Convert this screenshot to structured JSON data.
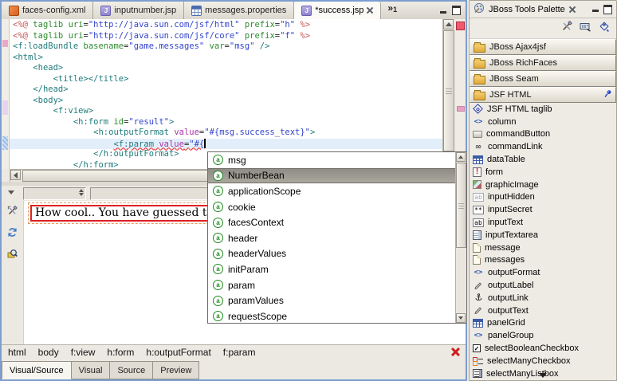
{
  "editor_tabs": {
    "tabs": [
      {
        "label": "faces-config.xml",
        "icon": "xml-file",
        "active": false,
        "closable": false
      },
      {
        "label": "inputnumber.jsp",
        "icon": "jsp-file",
        "active": false,
        "closable": false
      },
      {
        "label": "messages.properties",
        "icon": "properties-file",
        "active": false,
        "closable": false
      },
      {
        "label": "*success.jsp",
        "icon": "jsp-file",
        "active": true,
        "closable": true
      }
    ],
    "more_glyph": "»",
    "more_count": "1"
  },
  "editor": {
    "cursor_line": 11,
    "lines": [
      [
        [
          "j",
          "<%@ "
        ],
        [
          "a",
          "taglib"
        ],
        [
          "p",
          " "
        ],
        [
          "a",
          "uri"
        ],
        [
          "eq",
          "="
        ],
        [
          "s",
          "\"http://java.sun.com/jsf/html\""
        ],
        [
          "p",
          " "
        ],
        [
          "a",
          "prefix"
        ],
        [
          "eq",
          "="
        ],
        [
          "s",
          "\"h\""
        ],
        [
          "j",
          " %>"
        ]
      ],
      [
        [
          "j",
          "<%@ "
        ],
        [
          "a",
          "taglib"
        ],
        [
          "p",
          " "
        ],
        [
          "a",
          "uri"
        ],
        [
          "eq",
          "="
        ],
        [
          "s",
          "\"http://java.sun.com/jsf/core\""
        ],
        [
          "p",
          " "
        ],
        [
          "a",
          "prefix"
        ],
        [
          "eq",
          "="
        ],
        [
          "s",
          "\"f\""
        ],
        [
          "j",
          " %>"
        ]
      ],
      [
        [
          "t",
          "<f:loadBundle"
        ],
        [
          "p",
          " "
        ],
        [
          "a",
          "basename"
        ],
        [
          "eq",
          "="
        ],
        [
          "s",
          "\"game.messages\""
        ],
        [
          "p",
          " "
        ],
        [
          "a",
          "var"
        ],
        [
          "eq",
          "="
        ],
        [
          "s",
          "\"msg\""
        ],
        [
          "t",
          " />"
        ]
      ],
      [
        [
          "t",
          "<html>"
        ]
      ],
      [
        [
          "p",
          "    "
        ],
        [
          "t",
          "<head>"
        ]
      ],
      [
        [
          "p",
          "        "
        ],
        [
          "t",
          "<title></title>"
        ]
      ],
      [
        [
          "p",
          "    "
        ],
        [
          "t",
          "</head>"
        ]
      ],
      [
        [
          "p",
          "    "
        ],
        [
          "t",
          "<body>"
        ]
      ],
      [
        [
          "p",
          "        "
        ],
        [
          "t",
          "<f:view>"
        ]
      ],
      [
        [
          "p",
          "            "
        ],
        [
          "t",
          "<h:form"
        ],
        [
          "p",
          " "
        ],
        [
          "a",
          "id"
        ],
        [
          "eq",
          "="
        ],
        [
          "s",
          "\"result\""
        ],
        [
          "t",
          ">"
        ]
      ],
      [
        [
          "p",
          "                "
        ],
        [
          "t",
          "<h:outputFormat"
        ],
        [
          "p",
          " "
        ],
        [
          "v",
          "value"
        ],
        [
          "eq",
          "="
        ],
        [
          "s",
          "\"#{msg.success_text}\""
        ],
        [
          "t",
          ">"
        ]
      ],
      [
        [
          "p",
          "                    "
        ],
        [
          "t",
          "<f:param",
          1
        ],
        [
          "p",
          " ",
          1
        ],
        [
          "v",
          "value",
          1
        ],
        [
          "eq",
          "=",
          1
        ],
        [
          "s",
          "\"#{",
          1
        ],
        [
          "caret",
          ""
        ]
      ],
      [
        [
          "p",
          "                "
        ],
        [
          "t",
          "</h:outputFormat>"
        ]
      ],
      [
        [
          "p",
          "            "
        ],
        [
          "t",
          "</h:form>"
        ]
      ]
    ]
  },
  "popup": {
    "items": [
      "msg",
      "NumberBean",
      "applicationScope",
      "cookie",
      "facesContext",
      "header",
      "headerValues",
      "initParam",
      "param",
      "paramValues",
      "requestScope"
    ],
    "selected_index": 1,
    "icon_letter": "a"
  },
  "visual": {
    "preview_text": "How cool.. You have guessed the n"
  },
  "breadcrumb": {
    "items": [
      "html",
      "body",
      "f:view",
      "h:form",
      "h:outputFormat",
      "f:param"
    ]
  },
  "bottom_tabs": [
    {
      "label": "Visual/Source",
      "active": true
    },
    {
      "label": "Visual",
      "active": false
    },
    {
      "label": "Source",
      "active": false
    },
    {
      "label": "Preview",
      "active": false
    }
  ],
  "palette": {
    "title": "JBoss Tools Palette",
    "toolbar_icons": [
      "palette-editor",
      "show-hide",
      "import"
    ],
    "sections": [
      {
        "label": "JBoss Ajax4jsf",
        "pinned": false
      },
      {
        "label": "JBoss RichFaces",
        "pinned": false
      },
      {
        "label": "JBoss Seam",
        "pinned": false
      },
      {
        "label": "JSF HTML",
        "pinned": true
      }
    ],
    "items": [
      {
        "label": "JSF HTML taglib",
        "icon": "taglib"
      },
      {
        "label": "column",
        "icon": "tags"
      },
      {
        "label": "commandButton",
        "icon": "button"
      },
      {
        "label": "commandLink",
        "icon": "link"
      },
      {
        "label": "dataTable",
        "icon": "table"
      },
      {
        "label": "form",
        "icon": "form"
      },
      {
        "label": "graphicImage",
        "icon": "image"
      },
      {
        "label": "inputHidden",
        "icon": "input-hidden"
      },
      {
        "label": "inputSecret",
        "icon": "input-secret"
      },
      {
        "label": "inputText",
        "icon": "input-text"
      },
      {
        "label": "inputTextarea",
        "icon": "textarea"
      },
      {
        "label": "message",
        "icon": "note"
      },
      {
        "label": "messages",
        "icon": "note"
      },
      {
        "label": "outputFormat",
        "icon": "tags"
      },
      {
        "label": "outputLabel",
        "icon": "pencil"
      },
      {
        "label": "outputLink",
        "icon": "anchor"
      },
      {
        "label": "outputText",
        "icon": "pencil"
      },
      {
        "label": "panelGrid",
        "icon": "table"
      },
      {
        "label": "panelGroup",
        "icon": "tags"
      },
      {
        "label": "selectBooleanCheckbox",
        "icon": "checkbox"
      },
      {
        "label": "selectManyCheckbox",
        "icon": "checklist"
      },
      {
        "label": "selectManyListbox",
        "icon": "listbox"
      }
    ]
  },
  "colors": {
    "active_part_frame": "#7d9ecf",
    "tag": "#1f7b7b",
    "attribute": "#2e8b2e",
    "string": "#3344cc",
    "jsp_directive": "#c75a5a",
    "jsf_value_attribute": "#a633a6",
    "error_underline": "#ee3333",
    "current_line_bg": "#e3eefb",
    "selection_bg": "#8e8c84",
    "error_overview_marker": "#ef5a6e",
    "preview_selection_border": "#dd2222",
    "preview_outline_border": "#e69a5c"
  }
}
